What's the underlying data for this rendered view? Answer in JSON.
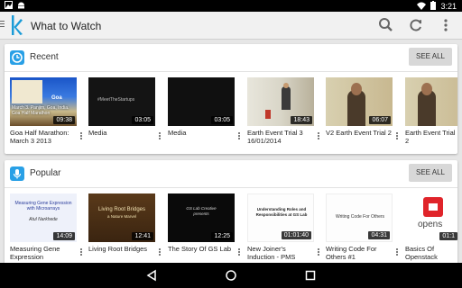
{
  "status": {
    "time": "3:21"
  },
  "appbar": {
    "title": "What to Watch"
  },
  "sections": [
    {
      "title": "Recent",
      "see_all": "SEE ALL",
      "items": [
        {
          "title": "Goa Half Marathon: March 3 2013",
          "duration": "09:38"
        },
        {
          "title": "Media",
          "duration": "03:05"
        },
        {
          "title": "Media",
          "duration": "03:05"
        },
        {
          "title": "Earth Event Trial 3 16/01/2014",
          "duration": "18:43"
        },
        {
          "title": "V2 Earth Event Trial 2",
          "duration": "06:07"
        },
        {
          "title": "Earth Event Trial 2",
          "duration": ""
        }
      ]
    },
    {
      "title": "Popular",
      "see_all": "SEE ALL",
      "items": [
        {
          "title": "Measuring Gene Expression",
          "duration": "14:09"
        },
        {
          "title": "Living Root Bridges",
          "duration": "12:41"
        },
        {
          "title": "The Story Of GS Lab",
          "duration": "12:25"
        },
        {
          "title": "New Joiner's Induction - PMS And...",
          "duration": "01:01:40"
        },
        {
          "title": "Writing Code For Others #1",
          "duration": "04:31"
        },
        {
          "title": "Basics Of Openstack",
          "duration": "01:1"
        }
      ]
    }
  ],
  "thumb_text": {
    "goa_lines": [
      "March 3. Panjim, Goa, India.",
      "Goa Half Marathon"
    ],
    "goa_logo": "Goa",
    "media_hashtag": "#MeetTheStartups",
    "gene_lines": [
      "Measuring Gene Expression",
      "with Microarrays",
      "Atul Narkhede"
    ],
    "root_lines": [
      "Living Root Bridges",
      "a Nature Marvel"
    ],
    "gslab_lines": [
      "GS Lab Creative",
      "presents"
    ],
    "induction_lines": [
      "Understanding Roles and",
      "Responsibilities at GS Lab"
    ],
    "code_line": "Writing Code For Others",
    "openstack_word": "opens"
  },
  "colors": {
    "accent": "#29a0e6",
    "logo": "#1a9bd7",
    "openstack": "#e0242a"
  }
}
